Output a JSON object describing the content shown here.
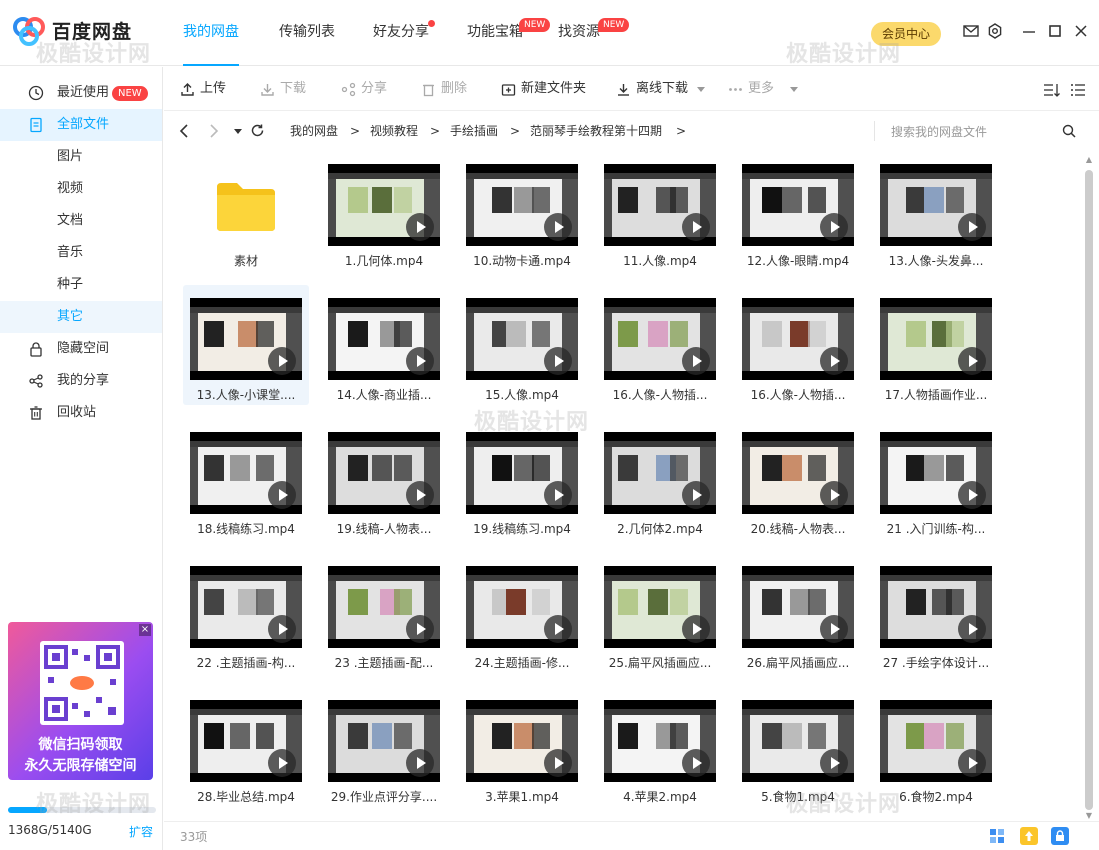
{
  "app": {
    "title": "百度网盘"
  },
  "nav": {
    "tabs": [
      {
        "label": "我的网盘"
      },
      {
        "label": "传输列表"
      },
      {
        "label": "好友分享"
      },
      {
        "label": "功能宝箱",
        "badge": "NEW"
      },
      {
        "label": "找资源",
        "badge": "NEW"
      }
    ],
    "vip_label": "会员中心"
  },
  "sidebar": {
    "recent": {
      "label": "最近使用",
      "badge": "NEW"
    },
    "all_files": "全部文件",
    "sub_items": [
      "图片",
      "视频",
      "文档",
      "音乐",
      "种子",
      "其它"
    ],
    "hidden_space": "隐藏空间",
    "my_share": "我的分享",
    "recycle": "回收站",
    "ad": {
      "line1": "微信扫码领取",
      "line2": "永久无限存储空间"
    },
    "quota_text": "1368G/5140G",
    "quota_fraction": 0.266,
    "expand_label": "扩容"
  },
  "toolbar": {
    "upload": "上传",
    "download": "下载",
    "share": "分享",
    "delete": "删除",
    "new_folder": "新建文件夹",
    "offline_download": "离线下载",
    "more": "更多"
  },
  "path": {
    "crumbs": [
      "我的网盘",
      "视频教程",
      "手绘插画",
      "范丽琴手绘教程第十四期"
    ],
    "search_placeholder": "搜索我的网盘文件"
  },
  "files": [
    {
      "name": "素材",
      "type": "folder"
    },
    {
      "name": "1.几何体.mp4",
      "type": "video"
    },
    {
      "name": "10.动物卡通.mp4",
      "type": "video"
    },
    {
      "name": "11.人像.mp4",
      "type": "video"
    },
    {
      "name": "12.人像-眼睛.mp4",
      "type": "video"
    },
    {
      "name": "13.人像-头发鼻...",
      "type": "video"
    },
    {
      "name": "13.人像-小课堂....",
      "type": "video"
    },
    {
      "name": "14.人像-商业插...",
      "type": "video"
    },
    {
      "name": "15.人像.mp4",
      "type": "video"
    },
    {
      "name": "16.人像-人物插...",
      "type": "video"
    },
    {
      "name": "16.人像-人物插...",
      "type": "video"
    },
    {
      "name": "17.人物插画作业...",
      "type": "video"
    },
    {
      "name": "18.线稿练习.mp4",
      "type": "video"
    },
    {
      "name": "19.线稿-人物表...",
      "type": "video"
    },
    {
      "name": "19.线稿练习.mp4",
      "type": "video"
    },
    {
      "name": "2.几何体2.mp4",
      "type": "video"
    },
    {
      "name": "20.线稿-人物表...",
      "type": "video"
    },
    {
      "name": "21 .入门训练-构...",
      "type": "video"
    },
    {
      "name": "22 .主题插画-构...",
      "type": "video"
    },
    {
      "name": "23 .主题插画-配...",
      "type": "video"
    },
    {
      "name": "24.主题插画-修...",
      "type": "video"
    },
    {
      "name": "25.扁平风插画应...",
      "type": "video"
    },
    {
      "name": "26.扁平风插画应...",
      "type": "video"
    },
    {
      "name": "27 .手绘字体设计...",
      "type": "video"
    },
    {
      "name": "28.毕业总结.mp4",
      "type": "video"
    },
    {
      "name": "29.作业点评分享....",
      "type": "video"
    },
    {
      "name": "3.苹果1.mp4",
      "type": "video"
    },
    {
      "name": "4.苹果2.mp4",
      "type": "video"
    },
    {
      "name": "5.食物1.mp4",
      "type": "video"
    },
    {
      "name": "6.食物2.mp4",
      "type": "video"
    }
  ],
  "status": {
    "count_label": "33项"
  },
  "colors": {
    "accent": "#06a7ff",
    "badge": "#fa4343",
    "vip": "#fbd96c"
  },
  "watermark": {
    "text": "极酷设计网"
  }
}
